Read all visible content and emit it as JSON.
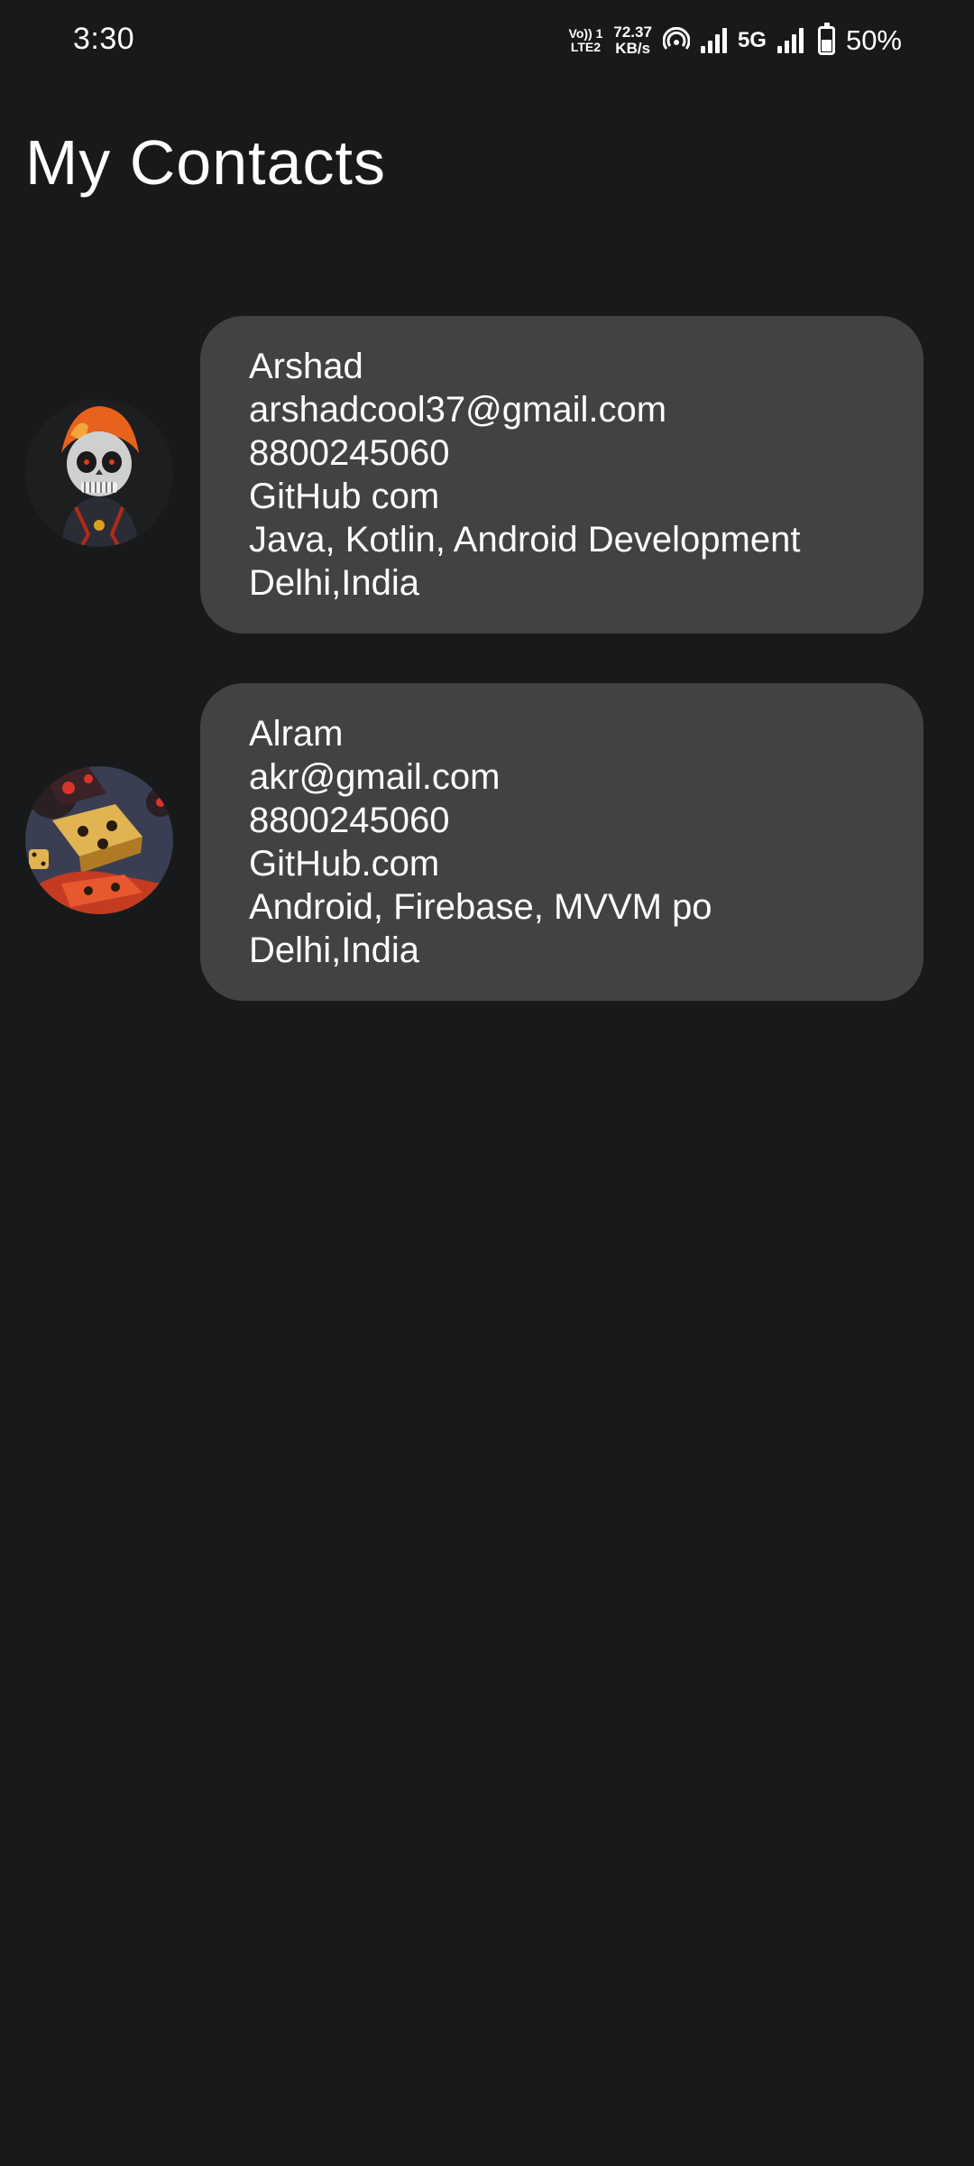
{
  "status_bar": {
    "time": "3:30",
    "volte_top": "Vo)) 1",
    "volte_bottom": "LTE2",
    "speed_value": "72.37",
    "speed_unit": "KB/s",
    "network": "5G",
    "battery": "50%",
    "battery_level": 0.5
  },
  "title": "My Contacts",
  "contacts": [
    {
      "name": "Arshad",
      "email": "arshadcool37@gmail.com",
      "phone": "8800245060",
      "link": "GitHub com",
      "skills": "Java, Kotlin, Android Development",
      "location": "Delhi,India",
      "avatar_icon": "skull-avatar"
    },
    {
      "name": "Alram",
      "email": "akr@gmail.com",
      "phone": "8800245060",
      "link": "GitHub.com",
      "skills": "Android, Firebase, MVVM po",
      "location": "Delhi,India",
      "avatar_icon": "dice-avatar"
    }
  ]
}
